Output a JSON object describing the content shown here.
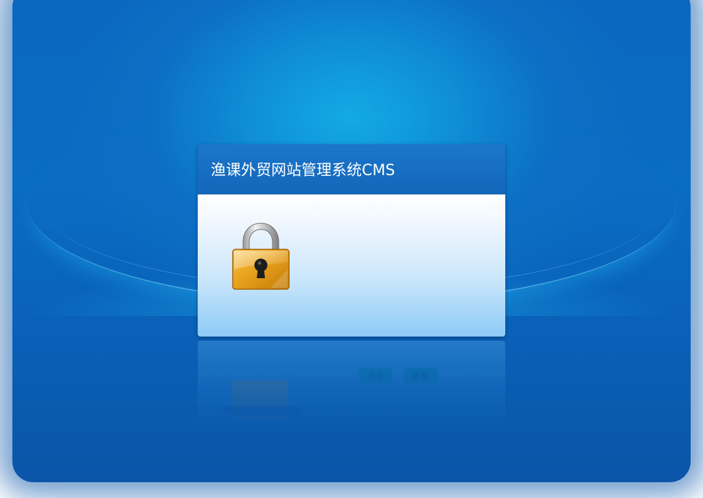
{
  "dialog": {
    "title": "渔课外贸网站管理系统CMS"
  },
  "icons": {
    "lock": "padlock-icon"
  },
  "reflection": {
    "login_label": "登录",
    "reset_label": "重置"
  },
  "colors": {
    "header": "#1567bb",
    "background": "#0b67bf",
    "lock_gold": "#e3a21a"
  }
}
